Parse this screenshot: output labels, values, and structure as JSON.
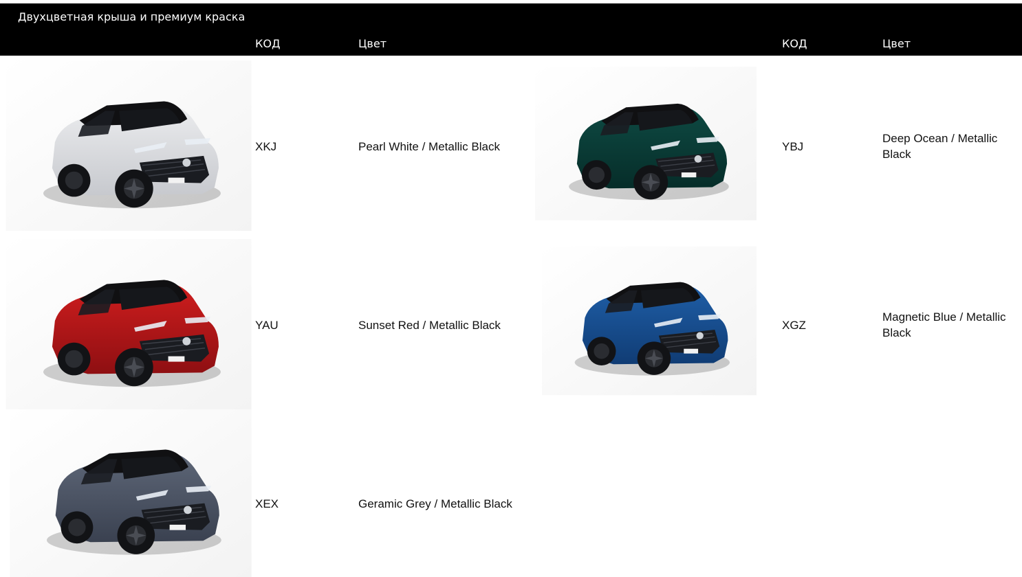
{
  "header": {
    "title": "Двухцветная крыша и премиум краска",
    "col_code_label": "КОД",
    "col_color_label": "Цвет"
  },
  "cars": [
    {
      "code": "XKJ",
      "color_name": "Pearl White / Metallic Black",
      "body_color": "#ECEDEF",
      "shade": "#C7C9CE",
      "roof_color": "#101012"
    },
    {
      "code": "YBJ",
      "color_name": "Deep Ocean / Metallic Black",
      "body_color": "#0E4A43",
      "shade": "#062D29",
      "roof_color": "#101012"
    },
    {
      "code": "YAU",
      "color_name": "Sunset Red / Metallic Black",
      "body_color": "#D01E1E",
      "shade": "#8E0F12",
      "roof_color": "#101012"
    },
    {
      "code": "XGZ",
      "color_name": "Magnetic Blue / Metallic Black",
      "body_color": "#1F5FA8",
      "shade": "#103C74",
      "roof_color": "#101012"
    },
    {
      "code": "XEX",
      "color_name": "Geramic Grey / Metallic Black",
      "body_color": "#5E6778",
      "shade": "#3A4150",
      "roof_color": "#101012"
    }
  ]
}
